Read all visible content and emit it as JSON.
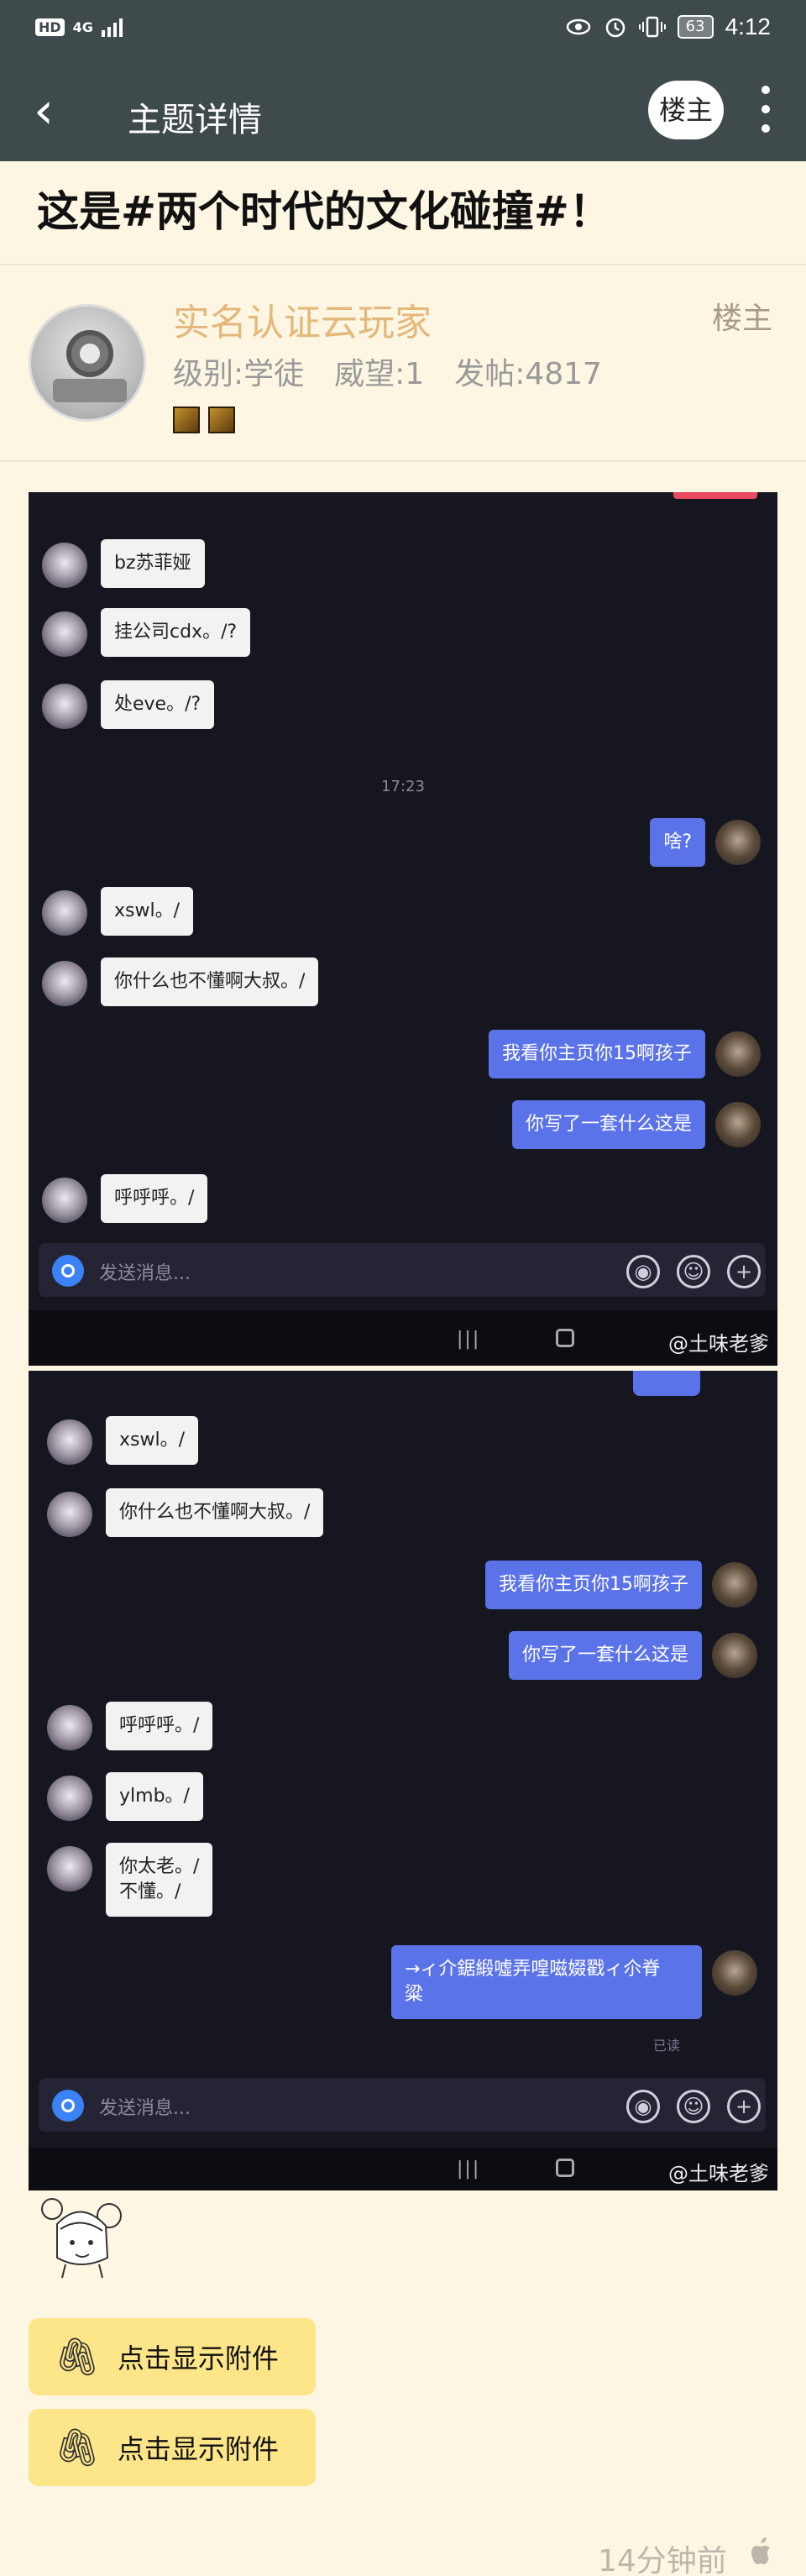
{
  "status_bar": {
    "network": "4G",
    "battery": "63",
    "time": "4:12",
    "icons": [
      "hd-icon",
      "signal-icon",
      "eye-icon",
      "alarm-icon",
      "vibrate-icon",
      "battery-icon"
    ]
  },
  "header": {
    "title": "主题详情",
    "op_button": "楼主",
    "back_icon": "back-arrow-icon",
    "more_icon": "more-vertical-icon",
    "background": "#3f4a4c"
  },
  "post": {
    "title": "这是#两个时代的文化碰撞#！",
    "author": {
      "name": "实名认证云玩家",
      "tag": "楼主",
      "level": "级别:学徒",
      "prestige": "威望:1",
      "posts": "发帖:4817",
      "name_color": "#e3b87a"
    },
    "time_ago": "14分钟前",
    "attachments": [
      "点击显示附件",
      "点击显示附件"
    ]
  },
  "screenshot1": {
    "messages": [
      {
        "side": "in",
        "text": "bz苏菲娅"
      },
      {
        "side": "in",
        "text": "挂公司cdx。/?"
      },
      {
        "side": "in",
        "text": "处eve。/?"
      },
      {
        "side": "out",
        "text": "啥?"
      },
      {
        "side": "in",
        "text": "xswl。/"
      },
      {
        "side": "in",
        "text": "你什么也不懂啊大叔。/"
      },
      {
        "side": "out",
        "text": "我看你主页你15啊孩子"
      },
      {
        "side": "out",
        "text": "你写了一套什么这是"
      },
      {
        "side": "in",
        "text": "呼呼呼。/"
      }
    ],
    "timestamp": "17:23",
    "input_placeholder": "发送消息...",
    "watermark": "@土味老爹"
  },
  "screenshot2": {
    "messages": [
      {
        "side": "in",
        "text": "xswl。/"
      },
      {
        "side": "in",
        "text": "你什么也不懂啊大叔。/"
      },
      {
        "side": "out",
        "text": "我看你主页你15啊孩子"
      },
      {
        "side": "out",
        "text": "你写了一套什么这是"
      },
      {
        "side": "in",
        "text": "呼呼呼。/"
      },
      {
        "side": "in",
        "text": "ylmb。/"
      },
      {
        "side": "in",
        "text": "你太老。/\n不懂。/"
      },
      {
        "side": "out",
        "text": "→ィ介鋸緞噓弄喤嗞娺戳ィ尒脊\n粱"
      }
    ],
    "read_receipt": "已读",
    "input_placeholder": "发送消息...",
    "watermark": "@土味老爹"
  }
}
